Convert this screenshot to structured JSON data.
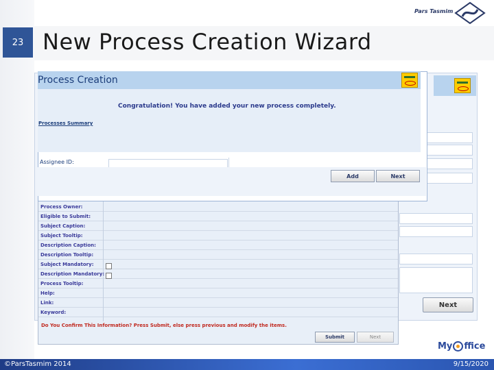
{
  "slide": {
    "number": "23",
    "title": "New Process Creation Wizard",
    "brand": "Pars Tasmim",
    "footer_left": "©ParsTasmim 2014",
    "footer_right": "9/15/2020",
    "myoffice_left": "My",
    "myoffice_right": "ffice"
  },
  "front_window": {
    "title": "Process Creation",
    "congrats": "Congratulation! You have added your new process completely.",
    "summary_label": "Processes Summary",
    "assignee_label": "Assignee ID:",
    "add_label": "Add",
    "next_label": "Next"
  },
  "form_window": {
    "fields": [
      "Process Owner:",
      "Eligible to Submit:",
      "Subject Caption:",
      "Subject Tooltip:",
      "Description Caption:",
      "Description Tooltip:",
      "Subject Mandatory:",
      "Description Mandatory:",
      "Process Tooltip:",
      "Help:",
      "Link:",
      "Keyword:"
    ],
    "confirm": "Do You Confirm This Information? Press Submit, else press previous and modify the items.",
    "submit_label": "Submit",
    "next_label": "Next"
  },
  "bg_window": {
    "next_label": "Next"
  },
  "colors": {
    "accent": "#2f5597",
    "header": "#b8d3ee",
    "confirm": "#c0281e"
  }
}
